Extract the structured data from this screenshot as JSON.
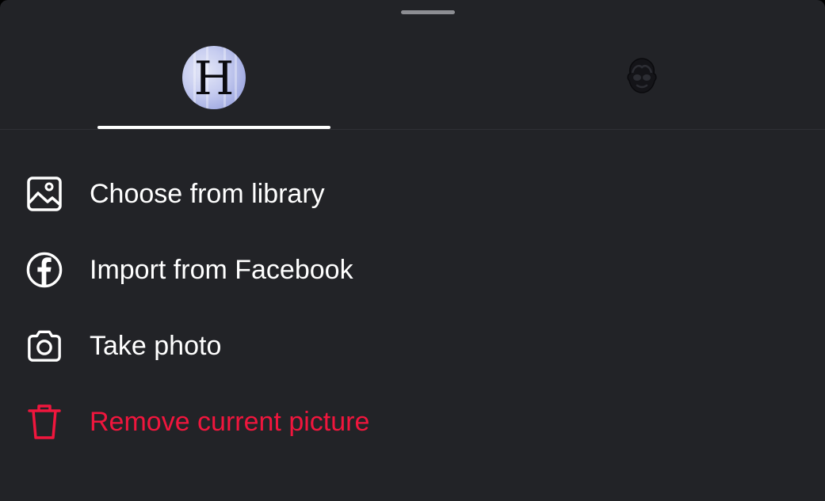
{
  "tabs": [
    {
      "name": "profile-picture",
      "profile_letter": "H",
      "selected": true
    },
    {
      "name": "avatar",
      "icon": "avatar-face-icon",
      "selected": false
    }
  ],
  "menu": {
    "items": [
      {
        "label": "Choose from library",
        "icon": "image-icon"
      },
      {
        "label": "Import from Facebook",
        "icon": "facebook-icon"
      },
      {
        "label": "Take photo",
        "icon": "camera-icon"
      },
      {
        "label": "Remove current picture",
        "icon": "trash-icon",
        "color": "#f0163d"
      }
    ]
  },
  "colors": {
    "background": "#222327",
    "text": "#ffffff",
    "danger": "#f0163d",
    "tab_indicator": "#ffffff"
  }
}
